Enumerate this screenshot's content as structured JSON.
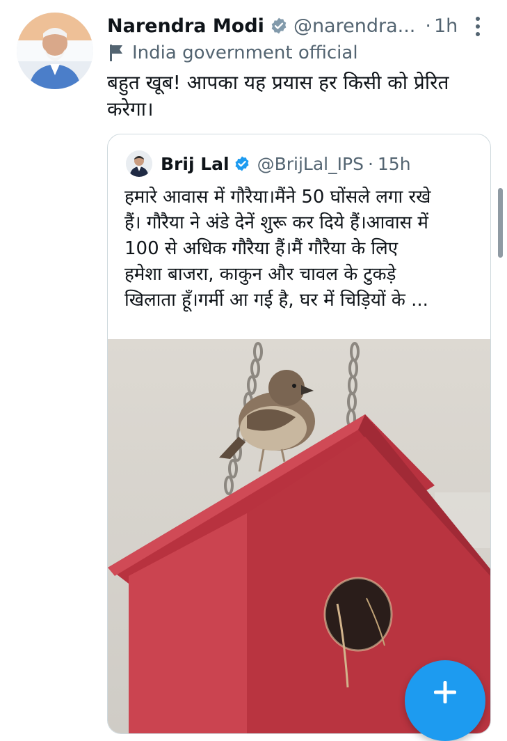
{
  "tweet": {
    "author_name": "Narendra Modi",
    "author_handle": "@narendra...",
    "separator": "·",
    "time": "1h",
    "label": "India government official",
    "text_line1": "बहुत खूब! आपका यह प्रयास हर किसी को प्रेरित",
    "text_line2": "करेगा।"
  },
  "quoted_tweet": {
    "author_name": "Brij Lal",
    "author_handle": "@BrijLal_IPS",
    "separator": "·",
    "time": "15h",
    "lines": [
      "हमारे आवास में गौरैया।मैंने 50 घोंसले लगा रखे",
      "हैं। गौरैया ने अंडे देनें शुरू कर दिये हैं।आवास में",
      "100 से अधिक गौरैया हैं।मैं गौरैया के लिए",
      "हमेशा बाजरा, काकुन और चावल के टुकड़े",
      "खिलाता हूँ।गर्मी आ गई है, घर में चिड़ियों के ..."
    ]
  },
  "icons": {
    "verified": "verified-badge-icon",
    "more": "more-vertical-icon",
    "flag": "flag-icon",
    "compose": "plus-icon"
  },
  "colors": {
    "accent": "#1d9bf0",
    "secondary_text": "#536471",
    "birdhouse_red": "#c43a46"
  }
}
